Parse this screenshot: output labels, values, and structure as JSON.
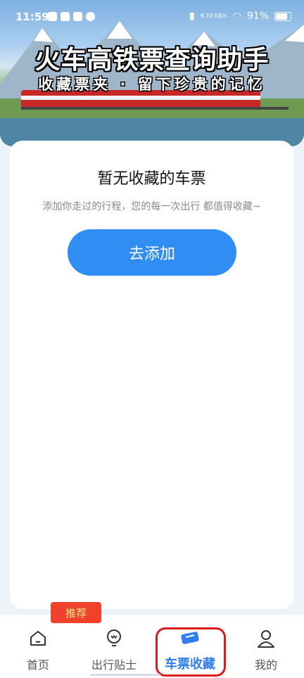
{
  "status_bar": {
    "time": "11:59",
    "net_speed": "6.10 KB/s",
    "battery": "91%"
  },
  "header": {
    "title": "火车高铁票查询助手",
    "subtitle": "收藏票夹 · 留下珍贵的记忆"
  },
  "empty_state": {
    "title": "暂无收藏的车票",
    "description": "添加你走过的行程，您的每一次出行 都值得收藏~",
    "add_button": "去添加"
  },
  "tabbar": {
    "badge": "推荐",
    "tabs": [
      {
        "label": "首页",
        "icon": "home-icon"
      },
      {
        "label": "出行贴士",
        "icon": "lightbulb-icon"
      },
      {
        "label": "车票收藏",
        "icon": "ticket-icon",
        "active": true
      },
      {
        "label": "我的",
        "icon": "user-icon"
      }
    ]
  },
  "colors": {
    "accent": "#2f8df3",
    "active_tab": "#2f7df0",
    "badge_bg": "#f0412c",
    "highlight": "#d81b1b"
  }
}
